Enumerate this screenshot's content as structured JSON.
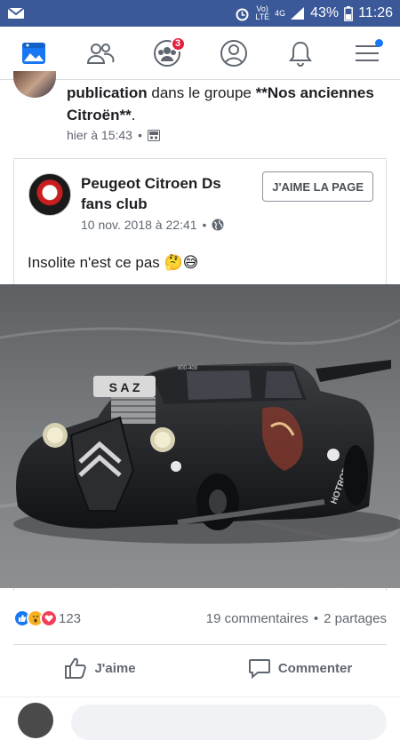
{
  "status_bar": {
    "network_small": "Vo)",
    "network_lte": "LTE",
    "network_4g": "4G",
    "battery": "43%",
    "time": "11:26"
  },
  "nav": {
    "groups_badge": "3"
  },
  "header_post": {
    "line_publication": "publication",
    "line_rest": " dans le groupe ",
    "group_name": "**Nos anciennes Citroën**",
    "period": ".",
    "timestamp": "hier à 15:43",
    "separator": "•"
  },
  "shared_post": {
    "page_name": "Peugeot Citroen Ds fans club",
    "date": "10 nov. 2018 à 22:41",
    "separator": "•",
    "like_page_button": "J'AIME LA PAGE",
    "caption": "Insolite n'est ce pas 🤔😅"
  },
  "photo": {
    "blower_text": "S A Z",
    "plate_text": "800-409",
    "side_text": "HOTROD"
  },
  "reactions": {
    "count": "123",
    "comments": "19 commentaires",
    "separator": "•",
    "shares": "2 partages"
  },
  "actions": {
    "like_label": "J'aime",
    "comment_label": "Commenter"
  }
}
